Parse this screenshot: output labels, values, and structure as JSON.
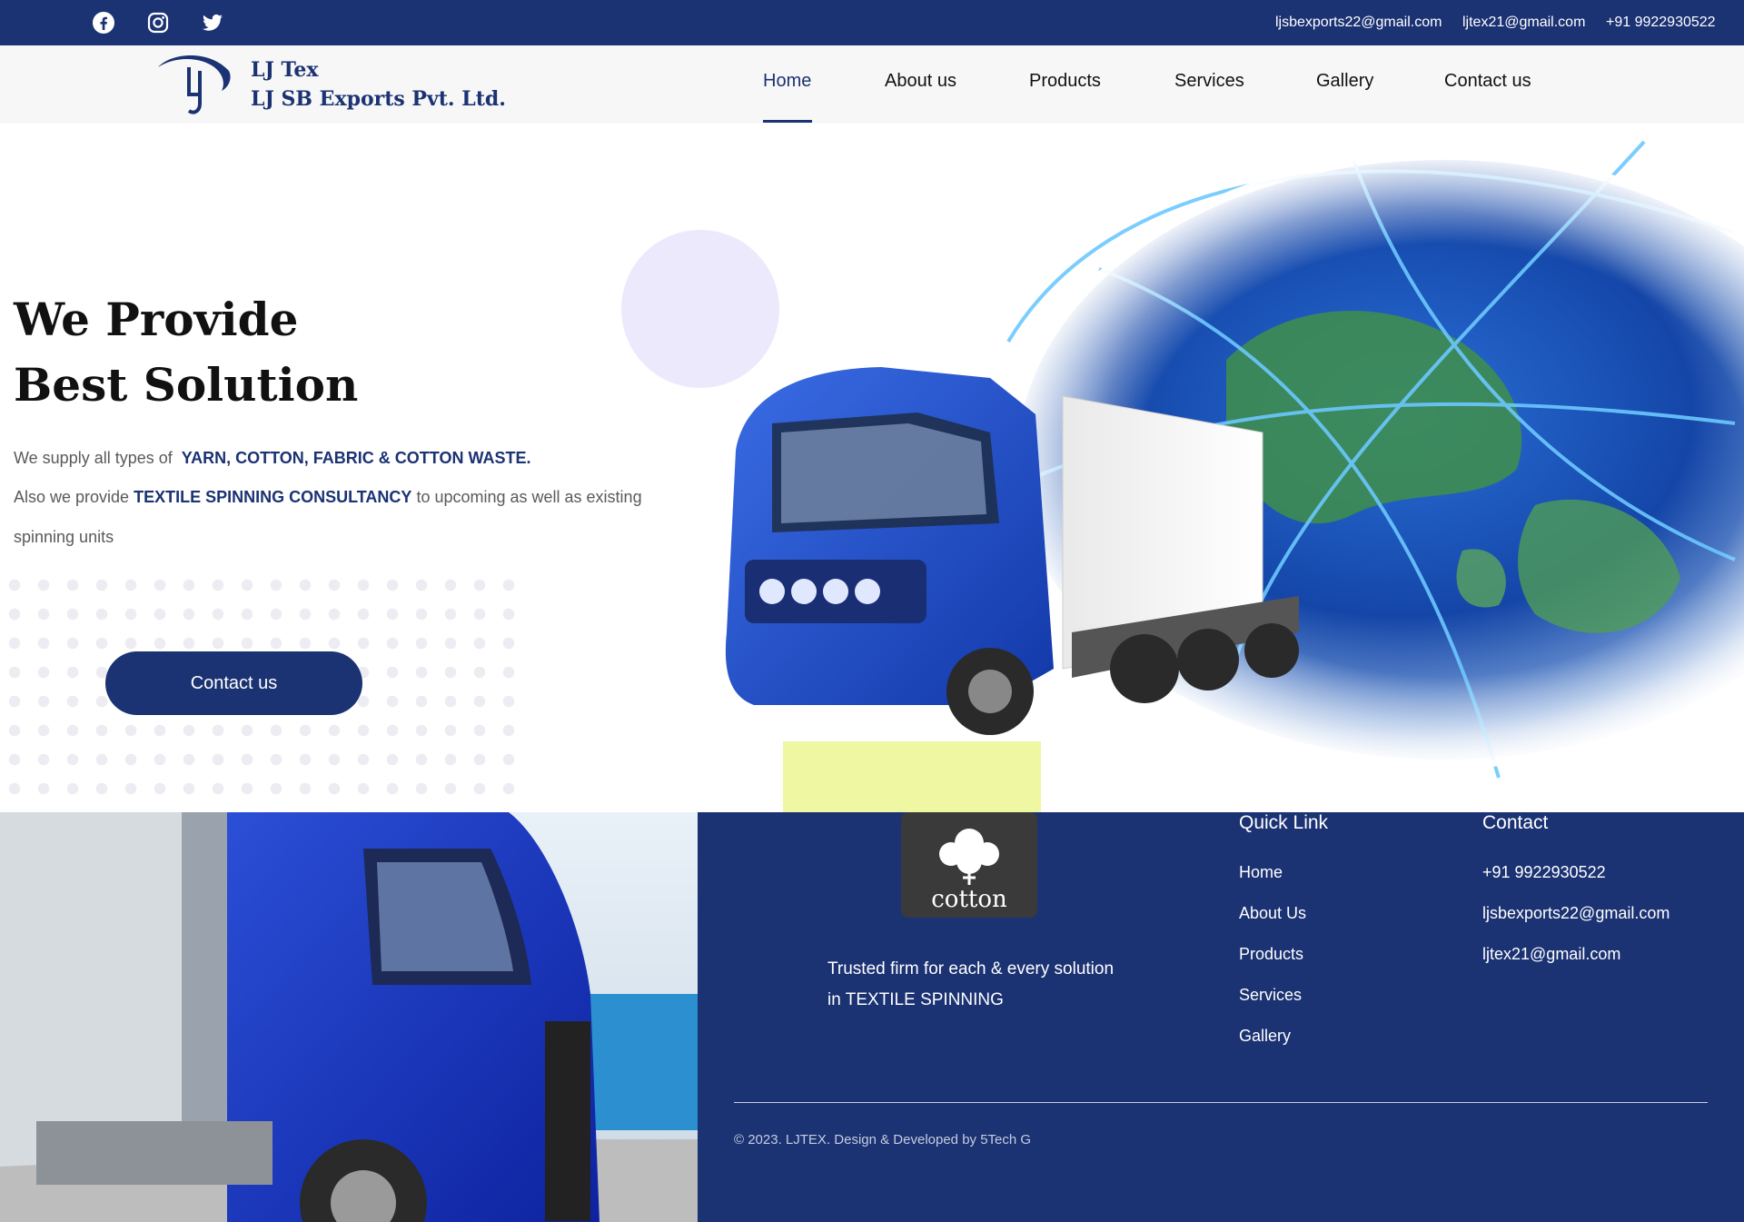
{
  "topbar": {
    "social": [
      "facebook-icon",
      "instagram-icon",
      "twitter-icon"
    ],
    "email1": "ljsbexports22@gmail.com",
    "email2": "ljtex21@gmail.com",
    "phone": "+91 9922930522"
  },
  "header": {
    "brand_line1": "LJ Tex",
    "brand_line2": "LJ SB Exports Pvt. Ltd.",
    "logo_text": "LJ",
    "nav": [
      "Home",
      "About us",
      "Products",
      "Services",
      "Gallery",
      "Contact us"
    ],
    "active_nav": "Home"
  },
  "hero": {
    "title_line1": "We Provide",
    "title_line2": "Best Solution",
    "line1_prefix": "We supply all types of",
    "line1_bold": "YARN, COTTON, FABRIC & COTTON WASTE.",
    "line2_prefix": "Also we provide",
    "line2_bold": "TEXTILE SPINNING CONSULTANCY",
    "line2_suffix": "to upcoming as well as existing",
    "line3": "spinning units",
    "button": "Contact us"
  },
  "footer": {
    "logo_text": "cotton",
    "tagline_line1": "Trusted firm for each & every solution",
    "tagline_line2": "in TEXTILE SPINNING",
    "quick_heading": "Quick Link",
    "quick_links": [
      "Home",
      "About Us",
      "Products",
      "Services",
      "Gallery"
    ],
    "contact_heading": "Contact",
    "contact_phone": "+91 9922930522",
    "contact_email1": "ljsbexports22@gmail.com",
    "contact_email2": "ljtex21@gmail.com",
    "copyright": "© 2023. LJTEX. Design & Developed by 5Tech G"
  },
  "colors": {
    "primary": "#1b3273",
    "lavender": "#ece9fc",
    "accent_yellow": "#f0f7a3"
  }
}
